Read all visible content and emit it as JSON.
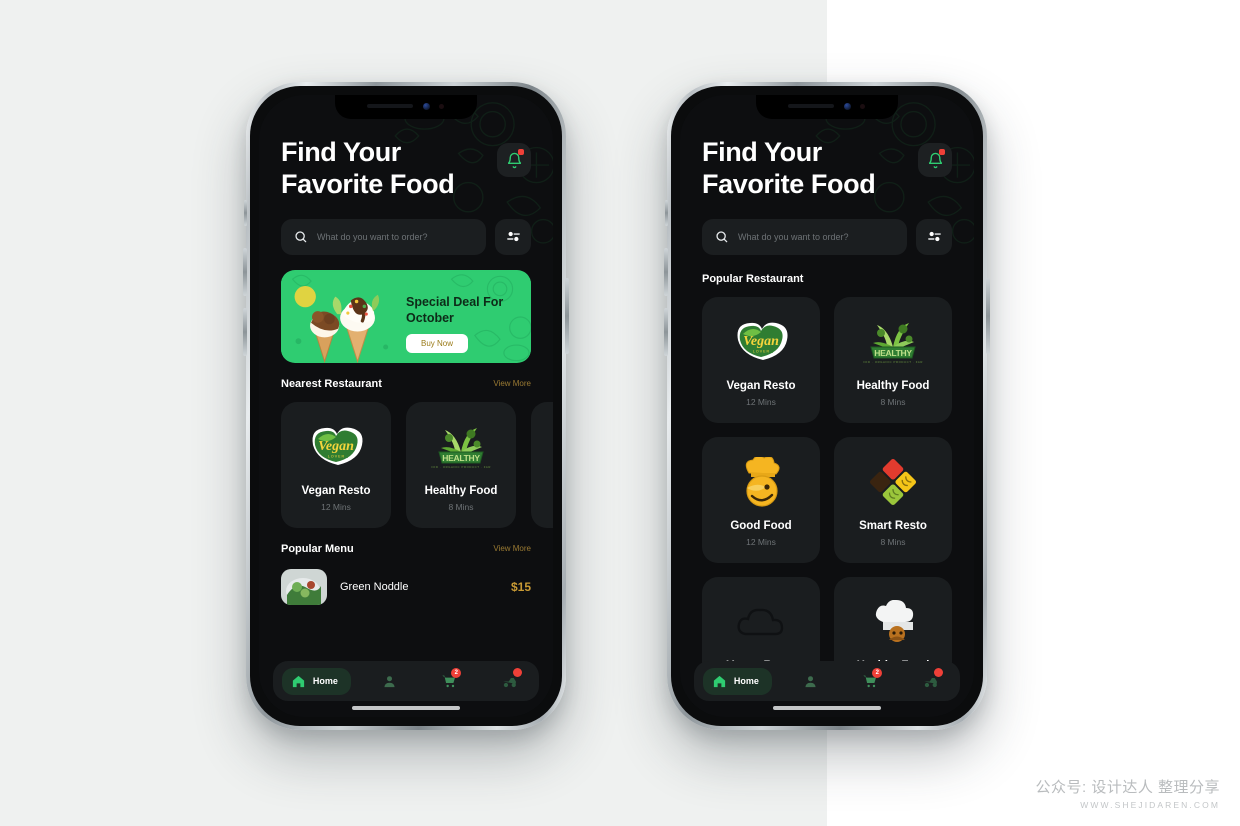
{
  "watermark": {
    "line1": "公众号: 设计达人 整理分享",
    "line2": "WWW.SHEJIDAREN.COM"
  },
  "colors": {
    "accent_green": "#2fcc71",
    "app_bg": "#0d0e10",
    "card_bg": "#1a1d1f",
    "badge_red": "#ef4038",
    "muted_text": "#6e7376",
    "gold": "#c89a34"
  },
  "screens": [
    {
      "id": "home-feed",
      "hero": {
        "title_line1": "Find Your",
        "title_line2": "Favorite Food",
        "bell_icon": "bell-icon",
        "bell_badge": true
      },
      "search": {
        "icon": "search-icon",
        "placeholder": "What do you want to order?",
        "value": "",
        "filter_icon": "filter-sliders-icon"
      },
      "banner": {
        "title_line1": "Special Deal For",
        "title_line2": "October",
        "cta_label": "Buy Now",
        "image": "ice-cream-cones"
      },
      "sections": [
        {
          "title": "Nearest Restaurant",
          "more_label": "View More",
          "layout": "hscroll",
          "items": [
            {
              "name": "Vegan Resto",
              "mins": "12 Mins",
              "logo": "vegan-lover-logo"
            },
            {
              "name": "Healthy Food",
              "mins": "8 Mins",
              "logo": "healthy-olive-logo"
            },
            {
              "name": "",
              "mins": "",
              "logo": "partial-card"
            }
          ]
        },
        {
          "title": "Popular Menu",
          "more_label": "View More",
          "layout": "list",
          "items": [
            {
              "name": "Green Noddle",
              "price": "$15",
              "thumb": "green-noddle-photo"
            }
          ]
        }
      ],
      "tabbar": {
        "items": [
          {
            "id": "home",
            "label": "Home",
            "icon": "home-icon",
            "active": true,
            "badge": ""
          },
          {
            "id": "profile",
            "label": "",
            "icon": "person-icon",
            "active": false,
            "badge": ""
          },
          {
            "id": "cart",
            "label": "",
            "icon": "cart-icon",
            "active": false,
            "badge": "2"
          },
          {
            "id": "orders",
            "label": "",
            "icon": "delivery-icon",
            "active": false,
            "badge": "dot"
          }
        ]
      }
    },
    {
      "id": "popular-restaurant",
      "hero": {
        "title_line1": "Find Your",
        "title_line2": "Favorite Food",
        "bell_icon": "bell-icon",
        "bell_badge": true
      },
      "search": {
        "icon": "search-icon",
        "placeholder": "What do you want to order?",
        "value": "",
        "filter_icon": "filter-sliders-icon"
      },
      "sections": [
        {
          "title": "Popular Restaurant",
          "more_label": "",
          "layout": "grid",
          "items": [
            {
              "name": "Vegan Resto",
              "mins": "12 Mins",
              "logo": "vegan-lover-logo"
            },
            {
              "name": "Healthy Food",
              "mins": "8 Mins",
              "logo": "healthy-olive-logo"
            },
            {
              "name": "Good Food",
              "mins": "12 Mins",
              "logo": "good-food-chef-logo"
            },
            {
              "name": "Smart Resto",
              "mins": "8 Mins",
              "logo": "smart-resto-diamond-logo"
            },
            {
              "name": "Vegan Resto",
              "mins": "",
              "logo": "cloud-logo"
            },
            {
              "name": "Healthy Food",
              "mins": "",
              "logo": "chef-hat-logo"
            }
          ]
        }
      ],
      "tabbar": {
        "items": [
          {
            "id": "home",
            "label": "Home",
            "icon": "home-icon",
            "active": true,
            "badge": ""
          },
          {
            "id": "profile",
            "label": "",
            "icon": "person-icon",
            "active": false,
            "badge": ""
          },
          {
            "id": "cart",
            "label": "",
            "icon": "cart-icon",
            "active": false,
            "badge": "2"
          },
          {
            "id": "orders",
            "label": "",
            "icon": "delivery-icon",
            "active": false,
            "badge": "dot"
          }
        ]
      }
    }
  ]
}
